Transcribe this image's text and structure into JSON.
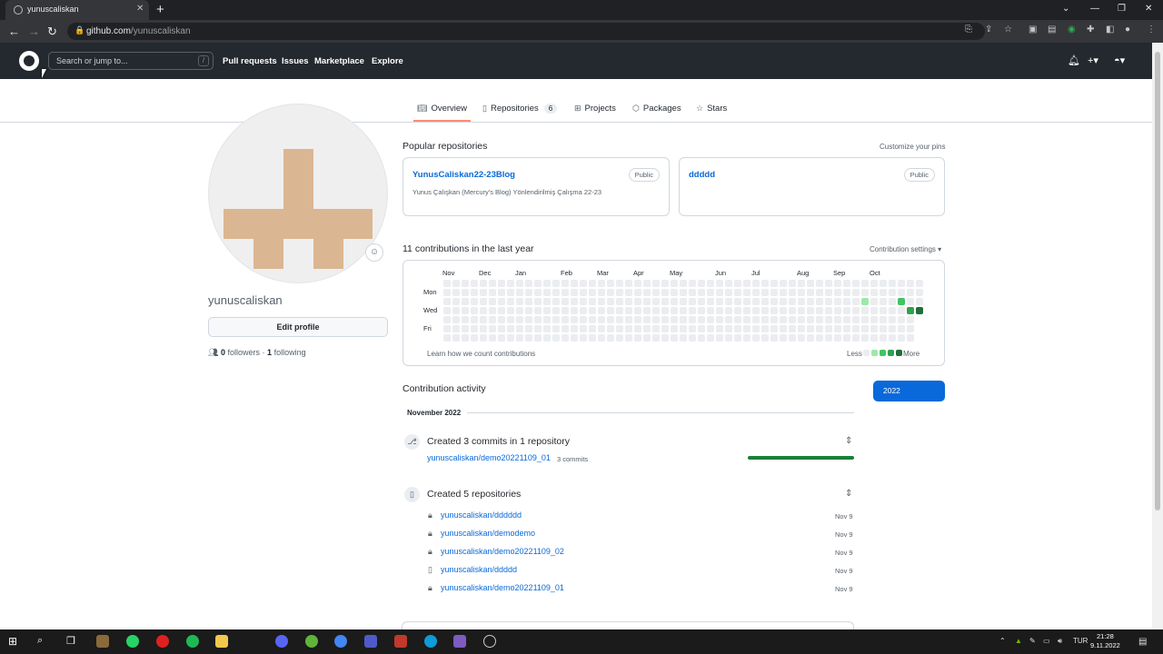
{
  "browser": {
    "tab_title": "yunuscaliskan",
    "tab_close": "✕",
    "new_tab": "+",
    "url_domain": "github.com",
    "url_path": "/yunuscaliskan"
  },
  "header": {
    "search_placeholder": "Search or jump to...",
    "search_shortcut": "/",
    "nav": [
      "Pull requests",
      "Issues",
      "Marketplace",
      "Explore"
    ]
  },
  "tabs": {
    "overview": "Overview",
    "repositories": "Repositories",
    "repositories_count": "6",
    "projects": "Projects",
    "packages": "Packages",
    "stars": "Stars"
  },
  "profile": {
    "username": "yunuscaliskan",
    "edit_button": "Edit profile",
    "followers_count": "0",
    "followers_label": "followers",
    "separator": "·",
    "following_count": "1",
    "following_label": "following"
  },
  "popular": {
    "title": "Popular repositories",
    "customize": "Customize your pins",
    "repos": [
      {
        "name": "YunusCaliskan22-23Blog",
        "badge": "Public",
        "desc": "Yunus Çalışkan (Mercury's Blog) Yönlendirilmiş Çalışma 22-23"
      },
      {
        "name": "ddddd",
        "badge": "Public",
        "desc": ""
      }
    ]
  },
  "contributions": {
    "title": "11 contributions in the last year",
    "settings": "Contribution settings ▾",
    "months": [
      "Nov",
      "Dec",
      "Jan",
      "Feb",
      "Mar",
      "Apr",
      "May",
      "Jun",
      "Jul",
      "Aug",
      "Sep",
      "Oct"
    ],
    "days": [
      "Mon",
      "Wed",
      "Fri"
    ],
    "learn": "Learn how we count contributions",
    "less": "Less",
    "more": "More",
    "colors": [
      "#ebedf0",
      "#9be9a8",
      "#40c463",
      "#30a14e",
      "#216e39"
    ]
  },
  "activity": {
    "title": "Contribution activity",
    "year": "2022",
    "month": "November 2022",
    "commits_title": "Created 3 commits in 1 repository",
    "commit_repo": "yunuscaliskan/demo20221109_01",
    "commit_count": "3 commits",
    "repos_title": "Created 5 repositories",
    "repos": [
      {
        "name": "yunuscaliskan/dddddd",
        "date": "Nov 9",
        "icon": "lock-icon"
      },
      {
        "name": "yunuscaliskan/demodemo",
        "date": "Nov 9",
        "icon": "lock-icon"
      },
      {
        "name": "yunuscaliskan/demo20221109_02",
        "date": "Nov 9",
        "icon": "lock-icon"
      },
      {
        "name": "yunuscaliskan/ddddd",
        "date": "Nov 9",
        "icon": "repo-icon"
      },
      {
        "name": "yunuscaliskan/demo20221109_01",
        "date": "Nov 9",
        "icon": "lock-icon"
      }
    ]
  },
  "taskbar": {
    "lang": "TUR",
    "time": "21:28",
    "date": "9.11.2022"
  }
}
